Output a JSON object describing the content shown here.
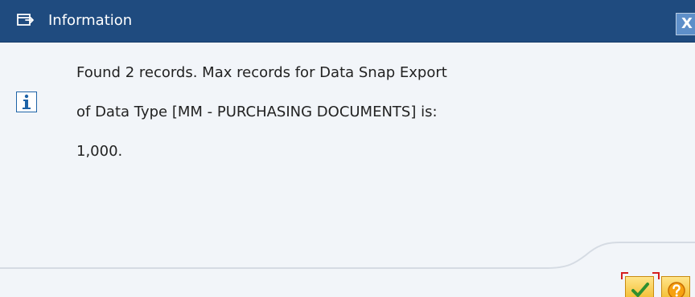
{
  "dialog": {
    "title": "Information",
    "close_label": "X",
    "message_lines": [
      "Found 2 records. Max records for Data Snap Export",
      "of Data Type [MM - PURCHASING DOCUMENTS] is:",
      "1,000."
    ],
    "icons": {
      "title": "external-window-icon",
      "message": "info-icon",
      "ok": "checkmark-icon",
      "help": "help-icon"
    },
    "colors": {
      "title_bar": "#1f4b7f",
      "dialog_background": "#f2f5f9",
      "button_yellow": "#f2b825",
      "checkmark_green": "#2f8f2f",
      "help_orange": "#f7a10f"
    }
  }
}
